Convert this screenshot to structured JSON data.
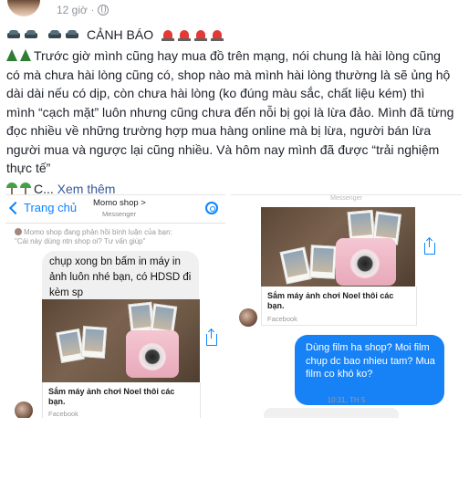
{
  "post": {
    "time": "12 giờ",
    "separator": "·",
    "title": "CẢNH BÁO",
    "lines": [
      "Trước giờ mình cũng hay mua đồ trên mạng, nói chung là hài lòng cũng",
      "có mà chưa hài lòng cũng có, shop nào mà mình hài lòng thường là sẽ ủng hộ",
      "dài dài nếu có dịp, còn chưa hài lòng (ko đúng màu sắc, chất liệu kém) thì",
      "mình “cạch mặt” luôn nhưng cũng chưa đến nỗi bị gọi là lừa đảo. Mình đã từng",
      "đọc nhiều về những trường hợp mua hàng online mà bị lừa, người bán lừa",
      "người mua và ngược lại cũng nhiều. Và hôm nay mình đã được “trải nghiệm",
      "thực tế”"
    ],
    "truncated": "C...",
    "see_more": "Xem thêm"
  },
  "left_screenshot": {
    "back_label": "Trang chủ",
    "shop_name": "Momo shop >",
    "shop_sub": "Messenger",
    "system_msg_1": "Momo shop đang phản hồi bình luận của bạn:",
    "system_msg_2": "\"Cái này dùng ntn shop oi? Tư vấn giúp\"",
    "bubble_text": "chụp xong bn bấm in máy in ảnh luôn nhé bạn, có HDSD đi kèm sp",
    "card_title_1": "Sắm máy ảnh chơi Noel thôi các",
    "card_title_2": "bạn.",
    "card_source": "Facebook"
  },
  "right_screenshot": {
    "top_label": "Messenger",
    "card_title_1": "Sắm máy ảnh chơi Noel thôi các",
    "card_title_2": "bạn.",
    "card_source": "Facebook",
    "bubble_text": "Dùng film ha shop? Moi film chụp dc bao nhieu tam? Mua film co khó ko?",
    "timestamp": "10:31, TH 5"
  }
}
